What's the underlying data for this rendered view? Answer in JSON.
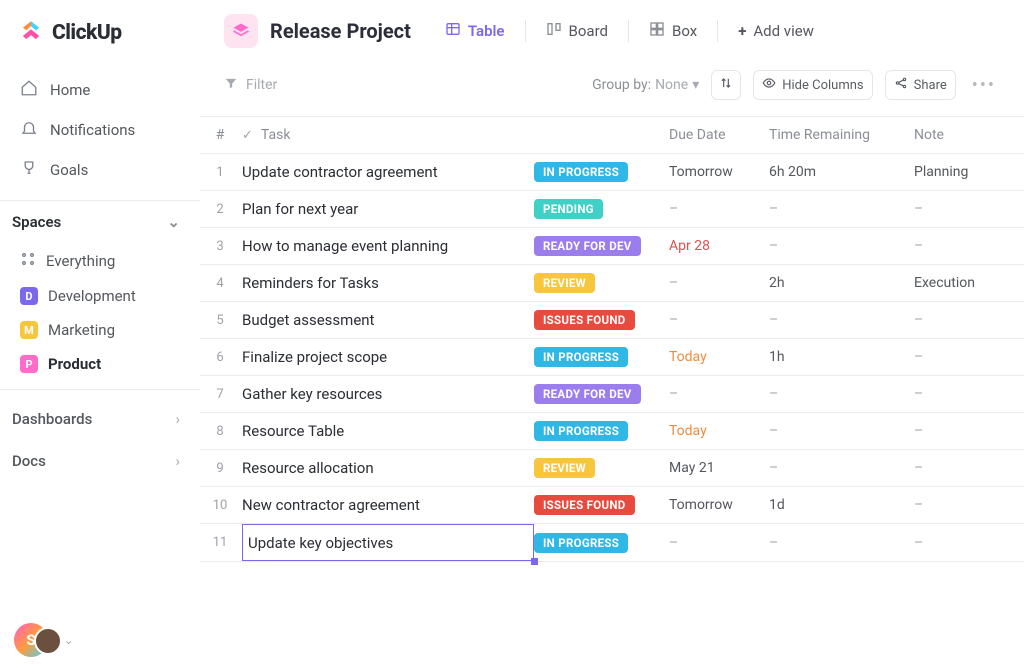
{
  "logo_text": "ClickUp",
  "nav": {
    "home": "Home",
    "notifications": "Notifications",
    "goals": "Goals"
  },
  "spaces_header": "Spaces",
  "spaces": {
    "everything": "Everything",
    "items": [
      {
        "letter": "D",
        "label": "Development",
        "color": "#7b68ee"
      },
      {
        "letter": "M",
        "label": "Marketing",
        "color": "#f8c63d"
      },
      {
        "letter": "P",
        "label": "Product",
        "color": "#ff6bcb"
      }
    ]
  },
  "dashboards_label": "Dashboards",
  "docs_label": "Docs",
  "project": {
    "title": "Release Project",
    "views": {
      "table": "Table",
      "board": "Board",
      "box": "Box",
      "add": "Add view"
    }
  },
  "toolbar": {
    "filter": "Filter",
    "groupby_label": "Group by:",
    "groupby_value": "None",
    "hide_columns": "Hide Columns",
    "share": "Share"
  },
  "columns": {
    "num": "#",
    "task": "Task",
    "due": "Due Date",
    "time": "Time Remaining",
    "note": "Note"
  },
  "tasks": [
    {
      "n": "1",
      "name": "Update contractor agreement",
      "status": "IN PROGRESS",
      "status_cls": "b-inprogress",
      "due": "Tomorrow",
      "due_cls": "",
      "time": "6h 20m",
      "note": "Planning"
    },
    {
      "n": "2",
      "name": "Plan for next year",
      "status": "PENDING",
      "status_cls": "b-pending",
      "due": "–",
      "due_cls": "dash",
      "time": "–",
      "note": "–"
    },
    {
      "n": "3",
      "name": "How to manage event planning",
      "status": "READY FOR DEV",
      "status_cls": "b-ready",
      "due": "Apr 28",
      "due_cls": "red",
      "time": "–",
      "note": "–"
    },
    {
      "n": "4",
      "name": "Reminders for Tasks",
      "status": "REVIEW",
      "status_cls": "b-review",
      "due": "–",
      "due_cls": "dash",
      "time": "2h",
      "note": "Execution"
    },
    {
      "n": "5",
      "name": "Budget assessment",
      "status": "ISSUES FOUND",
      "status_cls": "b-issues",
      "due": "–",
      "due_cls": "dash",
      "time": "–",
      "note": "–"
    },
    {
      "n": "6",
      "name": "Finalize project scope",
      "status": "IN PROGRESS",
      "status_cls": "b-inprogress",
      "due": "Today",
      "due_cls": "orange",
      "time": "1h",
      "note": "–"
    },
    {
      "n": "7",
      "name": "Gather key resources",
      "status": "READY FOR DEV",
      "status_cls": "b-ready",
      "due": "–",
      "due_cls": "dash",
      "time": "–",
      "note": "–"
    },
    {
      "n": "8",
      "name": "Resource Table",
      "status": "IN PROGRESS",
      "status_cls": "b-inprogress",
      "due": "Today",
      "due_cls": "orange",
      "time": "–",
      "note": "–"
    },
    {
      "n": "9",
      "name": "Resource allocation",
      "status": "REVIEW",
      "status_cls": "b-review",
      "due": "May 21",
      "due_cls": "",
      "time": "–",
      "note": "–"
    },
    {
      "n": "10",
      "name": "New contractor agreement",
      "status": "ISSUES FOUND",
      "status_cls": "b-issues",
      "due": "Tomorrow",
      "due_cls": "",
      "time": "1d",
      "note": "–"
    },
    {
      "n": "11",
      "name": "Update key objectives",
      "status": "IN PROGRESS",
      "status_cls": "b-inprogress",
      "due": "–",
      "due_cls": "dash",
      "time": "–",
      "note": "–"
    }
  ],
  "selected_index": 10,
  "avatar_letter": "S"
}
